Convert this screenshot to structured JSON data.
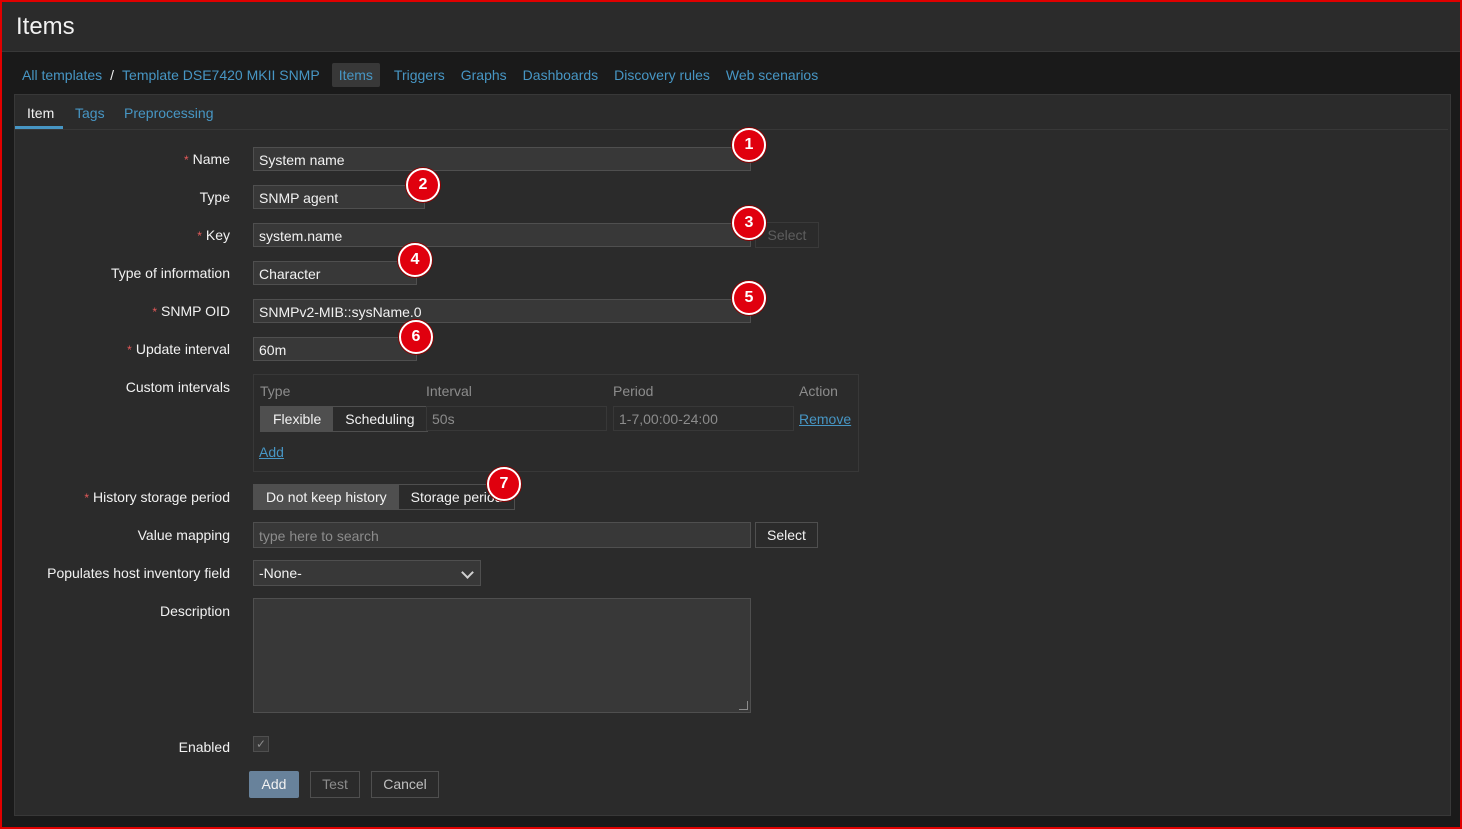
{
  "title": "Items",
  "breadcrumbs": {
    "all_templates": "All templates",
    "separator": "/",
    "template": "Template DSE7420 MKII SNMP",
    "items": [
      "Items",
      "Triggers",
      "Graphs",
      "Dashboards",
      "Discovery rules",
      "Web scenarios"
    ]
  },
  "tabs": [
    "Item",
    "Tags",
    "Preprocessing"
  ],
  "form": {
    "required_mark": "*",
    "name_label": "Name",
    "name_value": "System name",
    "type_label": "Type",
    "type_value": "SNMP agent",
    "key_label": "Key",
    "key_value": "system.name",
    "key_select": "Select",
    "type_info_label": "Type of information",
    "type_info_value": "Character",
    "snmp_oid_label": "SNMP OID",
    "snmp_oid_value": "SNMPv2-MIB::sysName.0",
    "update_interval_label": "Update interval",
    "update_interval_value": "60m",
    "custom_intervals_label": "Custom intervals",
    "ci_headers": [
      "Type",
      "Interval",
      "Period",
      "Action"
    ],
    "ci_flexible": "Flexible",
    "ci_scheduling": "Scheduling",
    "ci_interval": "50s",
    "ci_period": "1-7,00:00-24:00",
    "ci_remove": "Remove",
    "ci_add": "Add",
    "history_label": "History storage period",
    "history_opt1": "Do not keep history",
    "history_opt2": "Storage period",
    "value_mapping_label": "Value mapping",
    "value_mapping_placeholder": "type here to search",
    "value_mapping_select": "Select",
    "inventory_label": "Populates host inventory field",
    "inventory_value": "-None-",
    "description_label": "Description",
    "enabled_label": "Enabled",
    "enabled_check": "✓",
    "add_button": "Add",
    "test_button": "Test",
    "cancel_button": "Cancel"
  },
  "annotations": [
    "1",
    "2",
    "3",
    "4",
    "5",
    "6",
    "7"
  ],
  "colors": {
    "accent": "#4796c4",
    "frame": "#e00000",
    "badge": "#e0000e",
    "primary_button": "#68829b"
  }
}
